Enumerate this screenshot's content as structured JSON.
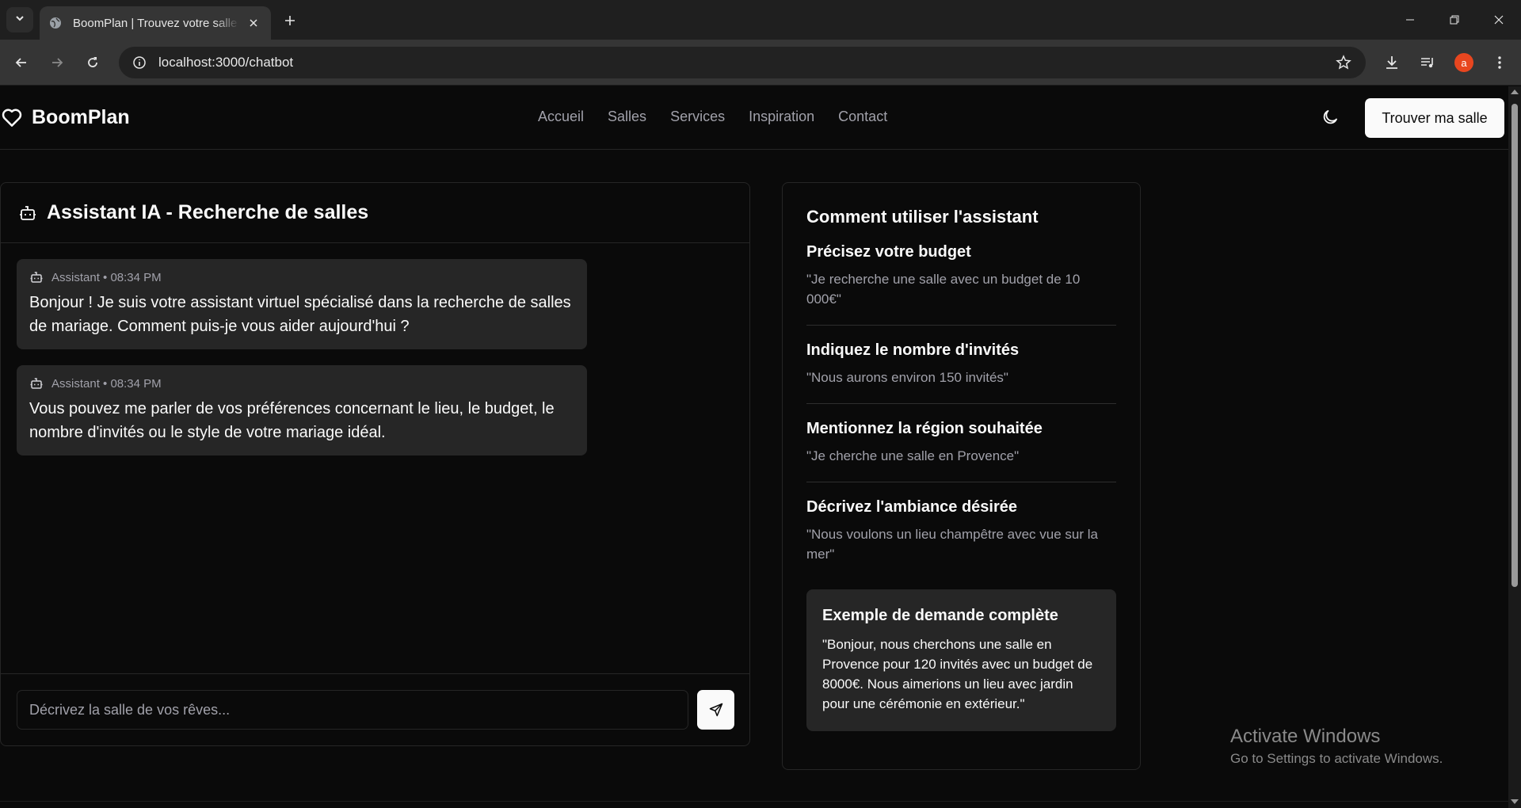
{
  "browser": {
    "tab_title": "BoomPlan | Trouvez votre salle de mariage",
    "url": "localhost:3000/chatbot",
    "profile_initial": "a"
  },
  "header": {
    "logo": "BoomPlan",
    "nav": [
      "Accueil",
      "Salles",
      "Services",
      "Inspiration",
      "Contact"
    ],
    "cta": "Trouver ma salle"
  },
  "chat": {
    "title": "Assistant IA - Recherche de salles",
    "messages": [
      {
        "meta": "Assistant • 08:34 PM",
        "text": "Bonjour ! Je suis votre assistant virtuel spécialisé dans la recherche de salles de mariage. Comment puis-je vous aider aujourd'hui ?"
      },
      {
        "meta": "Assistant • 08:34 PM",
        "text": "Vous pouvez me parler de vos préférences concernant le lieu, le budget, le nombre d'invités ou le style de votre mariage idéal."
      }
    ],
    "input_placeholder": "Décrivez la salle de vos rêves..."
  },
  "help": {
    "title": "Comment utiliser l'assistant",
    "tips": [
      {
        "title": "Précisez votre budget",
        "text": "\"Je recherche une salle avec un budget de 10 000€\""
      },
      {
        "title": "Indiquez le nombre d'invités",
        "text": "\"Nous aurons environ 150 invités\""
      },
      {
        "title": "Mentionnez la région souhaitée",
        "text": "\"Je cherche une salle en Provence\""
      },
      {
        "title": "Décrivez l'ambiance désirée",
        "text": "\"Nous voulons un lieu champêtre avec vue sur la mer\""
      }
    ],
    "example": {
      "title": "Exemple de demande complète",
      "text": "\"Bonjour, nous cherchons une salle en Provence pour 120 invités avec un budget de 8000€. Nous aimerions un lieu avec jardin pour une cérémonie en extérieur.\""
    }
  },
  "watermark": {
    "title": "Activate Windows",
    "subtitle": "Go to Settings to activate Windows."
  },
  "colors": {
    "background": "#0a0a0a",
    "card": "#262626",
    "foreground": "#fafafa",
    "muted": "#a1a1aa",
    "avatar": "#e8461f"
  }
}
